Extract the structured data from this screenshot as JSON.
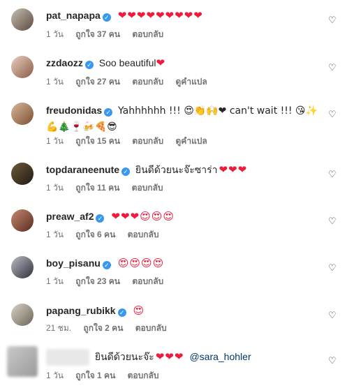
{
  "comments": [
    {
      "username": "pat_napapa",
      "text": "",
      "emoji": "❤❤❤❤❤❤❤❤❤",
      "time": "1 วัน",
      "likes": "ถูกใจ 37 คน",
      "reply": "ตอบกลับ",
      "translate": ""
    },
    {
      "username": "zzdaozz",
      "text": "Soo beautiful",
      "emoji": "❤",
      "time": "1 วัน",
      "likes": "ถูกใจ 27 คน",
      "reply": "ตอบกลับ",
      "translate": "ดูคำแปล"
    },
    {
      "username": "freudonidas",
      "text": "Yahhhhhh !!! 😍👏🙌❤ can't wait !!! 😘✨💪🎄🍷🍻🍕😎",
      "emoji": "",
      "time": "1 วัน",
      "likes": "ถูกใจ 15 คน",
      "reply": "ตอบกลับ",
      "translate": "ดูคำแปล"
    },
    {
      "username": "topdaraneenute",
      "text": "ยินดีด้วยนะจ๊ะซาร่า",
      "emoji": "❤❤❤",
      "time": "1 วัน",
      "likes": "ถูกใจ 11 คน",
      "reply": "ตอบกลับ",
      "translate": ""
    },
    {
      "username": "preaw_af2",
      "text": "",
      "emoji": "❤❤❤😍😍😍",
      "time": "1 วัน",
      "likes": "ถูกใจ 6 คน",
      "reply": "ตอบกลับ",
      "translate": ""
    },
    {
      "username": "boy_pisanu",
      "text": "",
      "emoji": "😍😍😍😍",
      "time": "1 วัน",
      "likes": "ถูกใจ 23 คน",
      "reply": "ตอบกลับ",
      "translate": ""
    },
    {
      "username": "papang_rubikk",
      "text": "",
      "emoji": "😍",
      "time": "21 ชม.",
      "likes": "ถูกใจ 2 คน",
      "reply": "ตอบกลับ",
      "translate": ""
    },
    {
      "username": "",
      "text": "ยินดีด้วยนะจ๊ะ",
      "emoji": "❤❤❤",
      "mention": "@sara_hohler",
      "time": "1 วัน",
      "likes": "ถูกใจ 1 คน",
      "reply": "ตอบกลับ",
      "translate": ""
    }
  ],
  "icons": {
    "verified": "verified-badge-icon",
    "like": "heart-outline-icon"
  },
  "colors": {
    "heart": "#ed1c3c",
    "verified": "#3897f0",
    "meta": "#737373",
    "mention": "#00376b"
  }
}
